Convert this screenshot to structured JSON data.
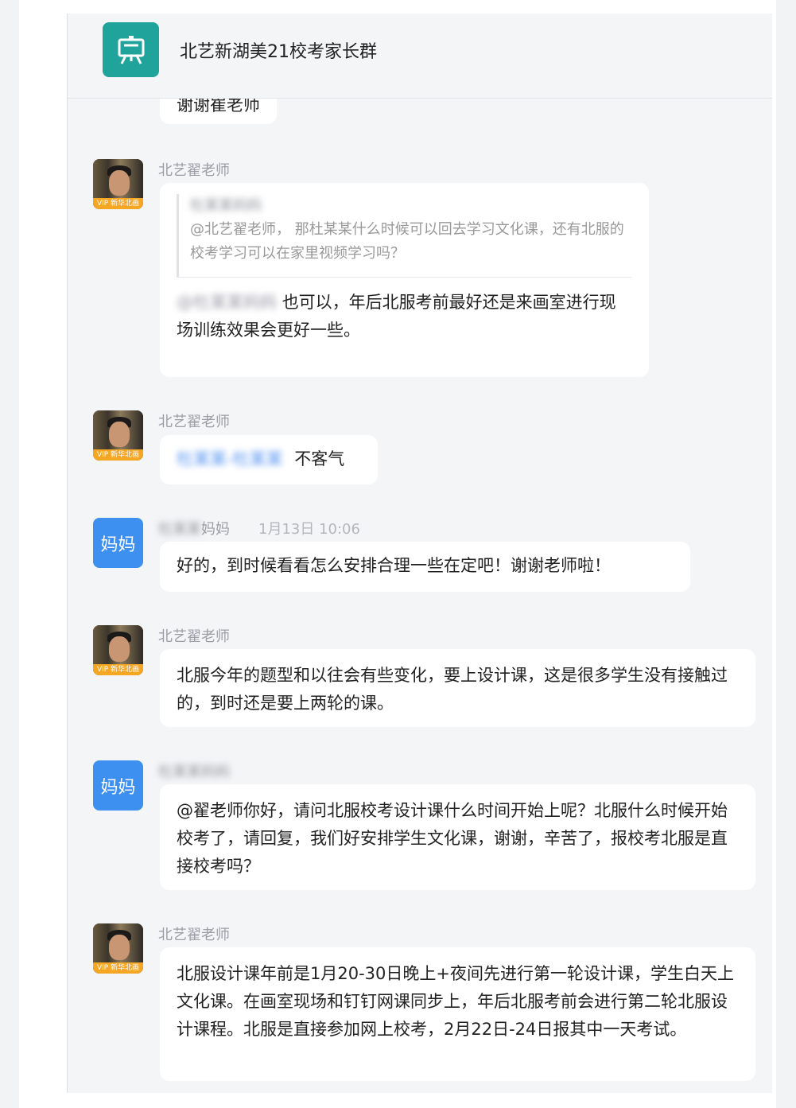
{
  "header": {
    "title": "北艺新湖美21校考家长群",
    "icon": "presentation-board-icon",
    "icon_color": "#1fa39a"
  },
  "messages": [
    {
      "text": "谢谢崔老师"
    },
    {
      "sender": "北艺翟老师",
      "avatar_tag": "VIP 新华北画",
      "quote_name": "杜某某妈妈",
      "quote_text": "@北艺翟老师， 那杜某某什么时候可以回去学习文化课，还有北服的校考学习可以在家里视频学习吗？",
      "mention": "@杜某某妈妈",
      "text": "也可以，年后北服考前最好还是来画室进行现场训练效果会更好一些。"
    },
    {
      "sender": "北艺翟老师",
      "avatar_tag": "VIP 新华北画",
      "mention": "杜某某-杜某某",
      "text": "不客气"
    },
    {
      "sender_blur": "杜某某",
      "sender_suffix": "妈妈",
      "time": "1月13日 10:06",
      "avatar_label": "妈妈",
      "text": "好的，到时候看看怎么安排合理一些在定吧！谢谢老师啦！"
    },
    {
      "sender": "北艺翟老师",
      "avatar_tag": "VIP 新华北画",
      "text": "北服今年的题型和以往会有些变化，要上设计课，这是很多学生没有接触过的，到时还是要上两轮的课。"
    },
    {
      "sender_blur": "杜某某妈妈",
      "avatar_label": "妈妈",
      "text": "@翟老师你好，请问北服校考设计课什么时间开始上呢？北服什么时候开始校考了，请回复，我们好安排学生文化课，谢谢，辛苦了，报校考北服是直接校考吗？"
    },
    {
      "sender": "北艺翟老师",
      "avatar_tag": "VIP 新华北画",
      "text": "北服设计课年前是1月20-30日晚上+夜间先进行第一轮设计课，学生白天上文化课。在画室现场和钉钉网课同步上，年后北服考前会进行第二轮北服设计课程。北服是直接参加网上校考，2月22日-24日报其中一天考试。"
    }
  ]
}
